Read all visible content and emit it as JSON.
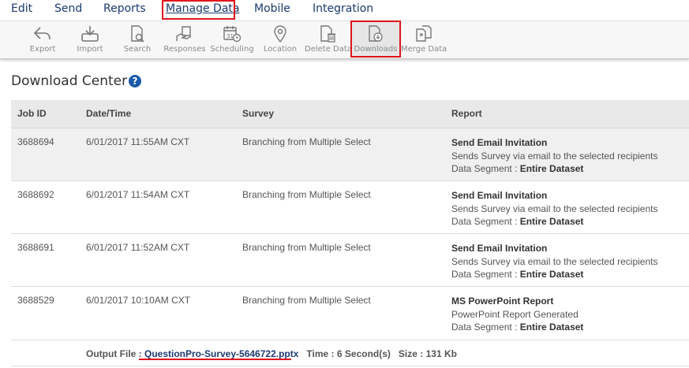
{
  "menu": {
    "items": [
      "Edit",
      "Send",
      "Reports",
      "Manage Data",
      "Mobile",
      "Integration"
    ],
    "active": "Manage Data"
  },
  "toolbar": {
    "items": [
      {
        "label": "Export",
        "icon": "export-arrow-icon"
      },
      {
        "label": "Import",
        "icon": "import-tray-icon"
      },
      {
        "label": "Search",
        "icon": "document-search-icon"
      },
      {
        "label": "Responses",
        "icon": "responses-hand-icon"
      },
      {
        "label": "Scheduling",
        "icon": "calendar-clock-icon"
      },
      {
        "label": "Location",
        "icon": "location-pin-icon"
      },
      {
        "label": "Delete Data",
        "icon": "document-trash-icon"
      },
      {
        "label": "Downloads",
        "icon": "document-download-icon"
      },
      {
        "label": "Merge Data",
        "icon": "merge-documents-icon"
      }
    ],
    "selected": "Downloads"
  },
  "page": {
    "title": "Download Center",
    "help_glyph": "?"
  },
  "table": {
    "headers": {
      "job_id": "Job ID",
      "datetime": "Date/Time",
      "survey": "Survey",
      "report": "Report"
    },
    "rows": [
      {
        "job_id": "3688694",
        "datetime": "6/01/2017 11:55AM CXT",
        "survey": "Branching from Multiple Select",
        "report_title": "Send Email Invitation",
        "report_desc": "Sends Survey via email to the selected recipients",
        "segment_label": "Data Segment : ",
        "segment_value": "Entire Dataset"
      },
      {
        "job_id": "3688692",
        "datetime": "6/01/2017 11:54AM CXT",
        "survey": "Branching from Multiple Select",
        "report_title": "Send Email Invitation",
        "report_desc": "Sends Survey via email to the selected recipients",
        "segment_label": "Data Segment : ",
        "segment_value": "Entire Dataset"
      },
      {
        "job_id": "3688691",
        "datetime": "6/01/2017 11:52AM CXT",
        "survey": "Branching from Multiple Select",
        "report_title": "Send Email Invitation",
        "report_desc": "Sends Survey via email to the selected recipients",
        "segment_label": "Data Segment : ",
        "segment_value": "Entire Dataset"
      },
      {
        "job_id": "3688529",
        "datetime": "6/01/2017 10:10AM CXT",
        "survey": "Branching from Multiple Select",
        "report_title": "MS PowerPoint Report",
        "report_desc": "PowerPoint Report Generated",
        "segment_label": "Data Segment : ",
        "segment_value": "Entire Dataset"
      }
    ],
    "output": {
      "label": "Output File : ",
      "file_name": "QuestionPro-Survey-5646722.pptx",
      "time": "Time : 6 Second(s)",
      "size": "Size : 131 Kb"
    }
  },
  "colors": {
    "menu_text": "#1b3a73",
    "highlight_red": "#e0131d",
    "help_blue": "#1b5bab",
    "header_bg": "#e9e9e9",
    "shaded_row": "#f0f0f0"
  }
}
